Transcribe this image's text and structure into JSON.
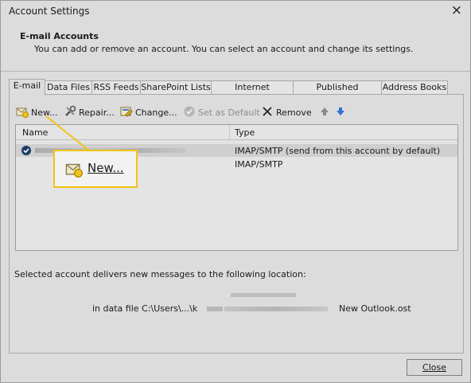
{
  "window": {
    "title": "Account Settings",
    "close_glyph": "×"
  },
  "header": {
    "title": "E-mail Accounts",
    "description": "You can add or remove an account. You can select an account and change its settings."
  },
  "tabs": [
    {
      "label": "E-mail",
      "active": true
    },
    {
      "label": "Data Files"
    },
    {
      "label": "RSS Feeds"
    },
    {
      "label": "SharePoint Lists"
    },
    {
      "label": "Internet Calendars"
    },
    {
      "label": "Published Calendars"
    },
    {
      "label": "Address Books"
    }
  ],
  "toolbar": {
    "new": "New...",
    "repair": "Repair...",
    "change": "Change...",
    "set_default": "Set as Default",
    "remove": "Remove"
  },
  "accounts_list": {
    "columns": {
      "name": "Name",
      "type": "Type"
    },
    "rows": [
      {
        "type": "IMAP/SMTP (send from this account by default)",
        "default": true
      },
      {
        "type": "IMAP/SMTP",
        "default": false
      }
    ]
  },
  "delivery": {
    "text": "Selected account delivers new messages to the following location:",
    "data_file_prefix": "in data file C:\\Users\\...\\k",
    "data_file_name": "New Outlook.ost"
  },
  "footer": {
    "close": "Close"
  },
  "callout": {
    "label": "New...",
    "border_color": "#f2c315"
  },
  "colors": {
    "arrow_up": "#8a8a8a",
    "arrow_down": "#2f6fd6",
    "check": "#1c3a66"
  }
}
